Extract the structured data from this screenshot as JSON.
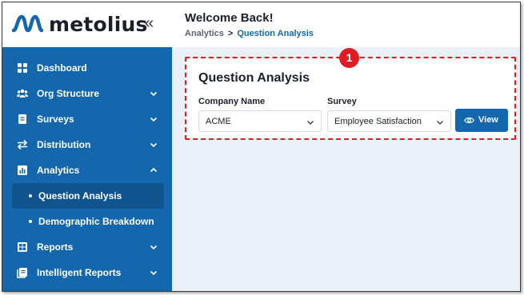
{
  "brand": {
    "name": "metolius",
    "collapse_glyph": "«"
  },
  "header": {
    "welcome": "Welcome Back!",
    "breadcrumb": {
      "parent": "Analytics",
      "separator": ">",
      "current": "Question Analysis"
    }
  },
  "sidebar": {
    "items": [
      {
        "label": "Dashboard",
        "icon": "grid-icon"
      },
      {
        "label": "Org Structure",
        "icon": "people-icon"
      },
      {
        "label": "Surveys",
        "icon": "clipboard-icon"
      },
      {
        "label": "Distribution",
        "icon": "arrows-icon"
      },
      {
        "label": "Analytics",
        "icon": "chart-icon"
      },
      {
        "label": "Question Analysis"
      },
      {
        "label": "Demographic Breakdown"
      },
      {
        "label": "Reports",
        "icon": "report-icon"
      },
      {
        "label": "Intelligent Reports",
        "icon": "book-icon"
      }
    ]
  },
  "card": {
    "title": "Question Analysis",
    "company_label": "Company Name",
    "company_value": "ACME",
    "survey_label": "Survey",
    "survey_value": "Employee Satisfaction",
    "view_label": "View"
  },
  "annotation": {
    "number": "1"
  },
  "colors": {
    "brand_blue": "#1467ad",
    "highlight_red": "#e01b24",
    "page_bg": "#eaf0f8"
  }
}
